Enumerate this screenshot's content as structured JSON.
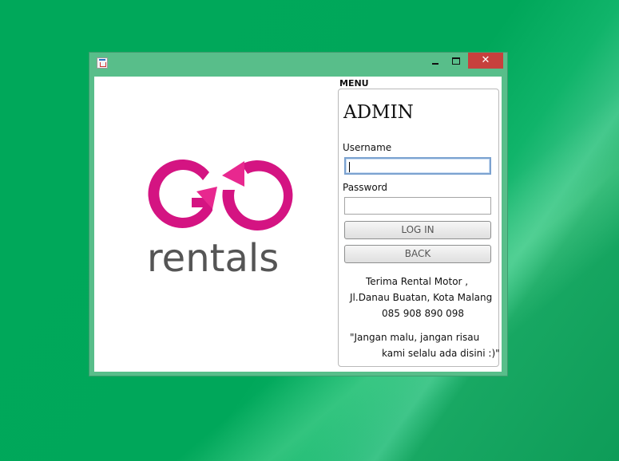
{
  "window": {
    "title": "",
    "close_glyph": "✕"
  },
  "logo": {
    "wordmark": "rentals",
    "brand_color": "#d41482",
    "text_color": "#555555"
  },
  "panel": {
    "menu_label": "MENU",
    "heading": "ADMIN",
    "username_label": "Username",
    "username_value": "",
    "password_label": "Password",
    "password_value": "",
    "login_button": "LOG IN",
    "back_button": "BACK"
  },
  "info": {
    "line1": "Terima Rental Motor ,",
    "line2": "Jl.Danau Buatan, Kota Malang",
    "line3": "085 908 890 098",
    "quote1": "\"Jangan malu, jangan risau",
    "quote2": "kami selalu ada disini :)\""
  },
  "colors": {
    "desktop": "#00a85a",
    "titlebar": "#58be8a",
    "close": "#c7403d"
  }
}
